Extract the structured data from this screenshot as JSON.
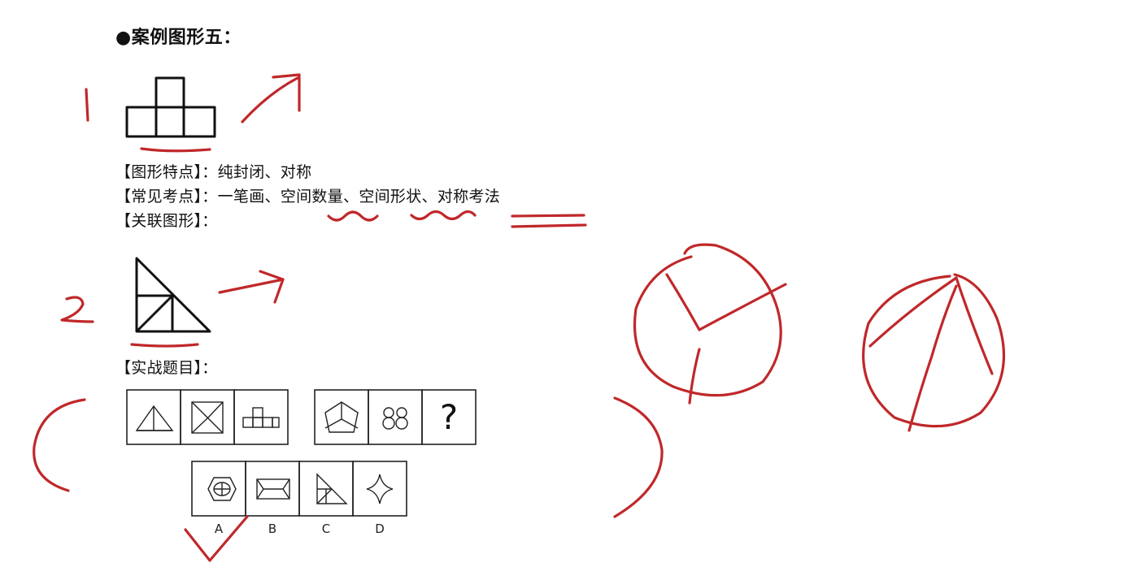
{
  "slide": {
    "title": "●案例图形五：",
    "feature_line": "【图形特点】：纯封闭、对称",
    "common_line": {
      "prefix": "【常见考点】：一笔画、",
      "item1": "空间数量",
      "sep1": "、",
      "item2": "空间形状",
      "sep2": "、",
      "item3": "对称考法"
    },
    "related_line": "【关联图形】：",
    "practice_line": "【实战题目】：",
    "question_mark": "?",
    "options": [
      "A",
      "B",
      "C",
      "D"
    ],
    "handwritten_numbers": [
      "1",
      "2"
    ]
  }
}
